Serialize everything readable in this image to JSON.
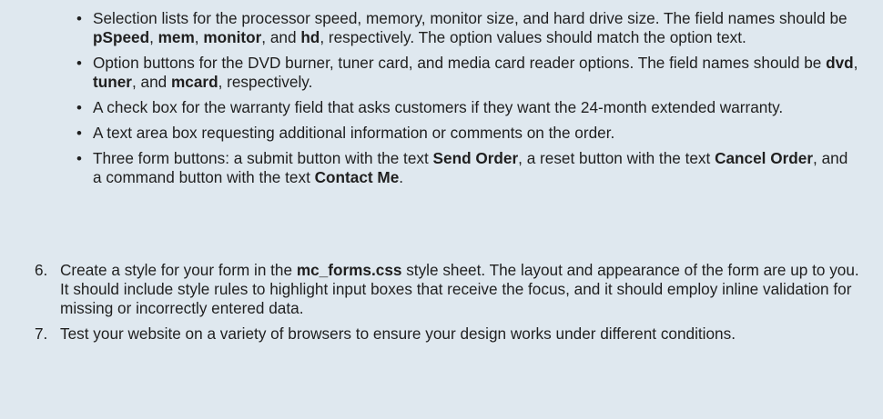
{
  "bullets": [
    {
      "marker": "•",
      "parts": [
        {
          "text": "Selection lists for the processor speed, memory, monitor size, and hard drive size. The field names should be ",
          "bold": false
        },
        {
          "text": "pSpeed",
          "bold": true
        },
        {
          "text": ", ",
          "bold": false
        },
        {
          "text": "mem",
          "bold": true
        },
        {
          "text": ", ",
          "bold": false
        },
        {
          "text": "monitor",
          "bold": true
        },
        {
          "text": ", and ",
          "bold": false
        },
        {
          "text": "hd",
          "bold": true
        },
        {
          "text": ", respectively. The option values should match the option text.",
          "bold": false
        }
      ]
    },
    {
      "marker": "•",
      "parts": [
        {
          "text": "Option buttons for the DVD burner, tuner card, and media card reader options. The field names should be ",
          "bold": false
        },
        {
          "text": "dvd",
          "bold": true
        },
        {
          "text": ", ",
          "bold": false
        },
        {
          "text": "tuner",
          "bold": true
        },
        {
          "text": ", and ",
          "bold": false
        },
        {
          "text": "mcard",
          "bold": true
        },
        {
          "text": ", respectively.",
          "bold": false
        }
      ]
    },
    {
      "marker": "•",
      "parts": [
        {
          "text": "A check box for the warranty field that asks customers if they want the 24-month extended warranty.",
          "bold": false
        }
      ]
    },
    {
      "marker": "•",
      "parts": [
        {
          "text": "A text area box requesting additional information or comments on the order.",
          "bold": false
        }
      ]
    },
    {
      "marker": "•",
      "parts": [
        {
          "text": "Three form buttons: a submit button with the text ",
          "bold": false
        },
        {
          "text": "Send Order",
          "bold": true
        },
        {
          "text": ", a reset button with the text ",
          "bold": false
        },
        {
          "text": "Cancel Order",
          "bold": true
        },
        {
          "text": ", and a command button with the text ",
          "bold": false
        },
        {
          "text": "Contact Me",
          "bold": true
        },
        {
          "text": ".",
          "bold": false
        }
      ]
    }
  ],
  "steps": [
    {
      "number": "6.",
      "parts": [
        {
          "text": "Create a style for your form in the ",
          "bold": false
        },
        {
          "text": "mc_forms.css",
          "bold": true
        },
        {
          "text": " style sheet. The layout and appearance of the form are up to you. It should include style rules to highlight input boxes that receive the focus, and it should employ inline validation for missing or incorrectly entered data.",
          "bold": false
        }
      ]
    },
    {
      "number": "7.",
      "parts": [
        {
          "text": "Test your website on a variety of browsers to ensure your design works under different conditions.",
          "bold": false
        }
      ]
    }
  ]
}
